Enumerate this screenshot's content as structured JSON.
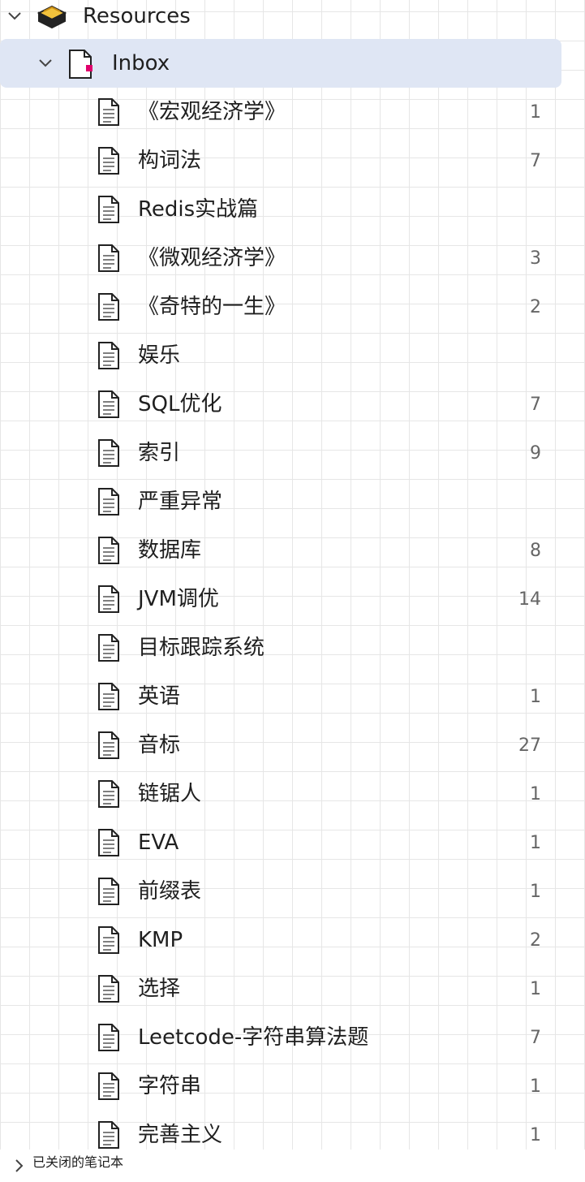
{
  "tree": {
    "resources": {
      "label": "Resources"
    },
    "inbox": {
      "label": "Inbox"
    },
    "notes": [
      {
        "title": "《宏观经济学》",
        "count": "1"
      },
      {
        "title": "构词法",
        "count": "7"
      },
      {
        "title": "Redis实战篇",
        "count": ""
      },
      {
        "title": "《微观经济学》",
        "count": "3"
      },
      {
        "title": "《奇特的一生》",
        "count": "2"
      },
      {
        "title": "娱乐",
        "count": ""
      },
      {
        "title": "SQL优化",
        "count": "7"
      },
      {
        "title": "索引",
        "count": "9"
      },
      {
        "title": "严重异常",
        "count": ""
      },
      {
        "title": "数据库",
        "count": "8"
      },
      {
        "title": "JVM调优",
        "count": "14"
      },
      {
        "title": "目标跟踪系统",
        "count": ""
      },
      {
        "title": "英语",
        "count": "1"
      },
      {
        "title": "音标",
        "count": "27"
      },
      {
        "title": "链锯人",
        "count": "1"
      },
      {
        "title": "EVA",
        "count": "1"
      },
      {
        "title": "前缀表",
        "count": "1"
      },
      {
        "title": "KMP",
        "count": "2"
      },
      {
        "title": "选择",
        "count": "1"
      },
      {
        "title": "Leetcode-字符串算法题",
        "count": "7"
      },
      {
        "title": "字符串",
        "count": "1"
      },
      {
        "title": "完善主义",
        "count": "1"
      }
    ],
    "closed_notebooks": {
      "label": "已关闭的笔记本"
    }
  },
  "colors": {
    "selection": "#dfe6f4",
    "grid": "#e6e6e6",
    "count_text": "#666666",
    "inbox_marker": "#e0006c"
  }
}
